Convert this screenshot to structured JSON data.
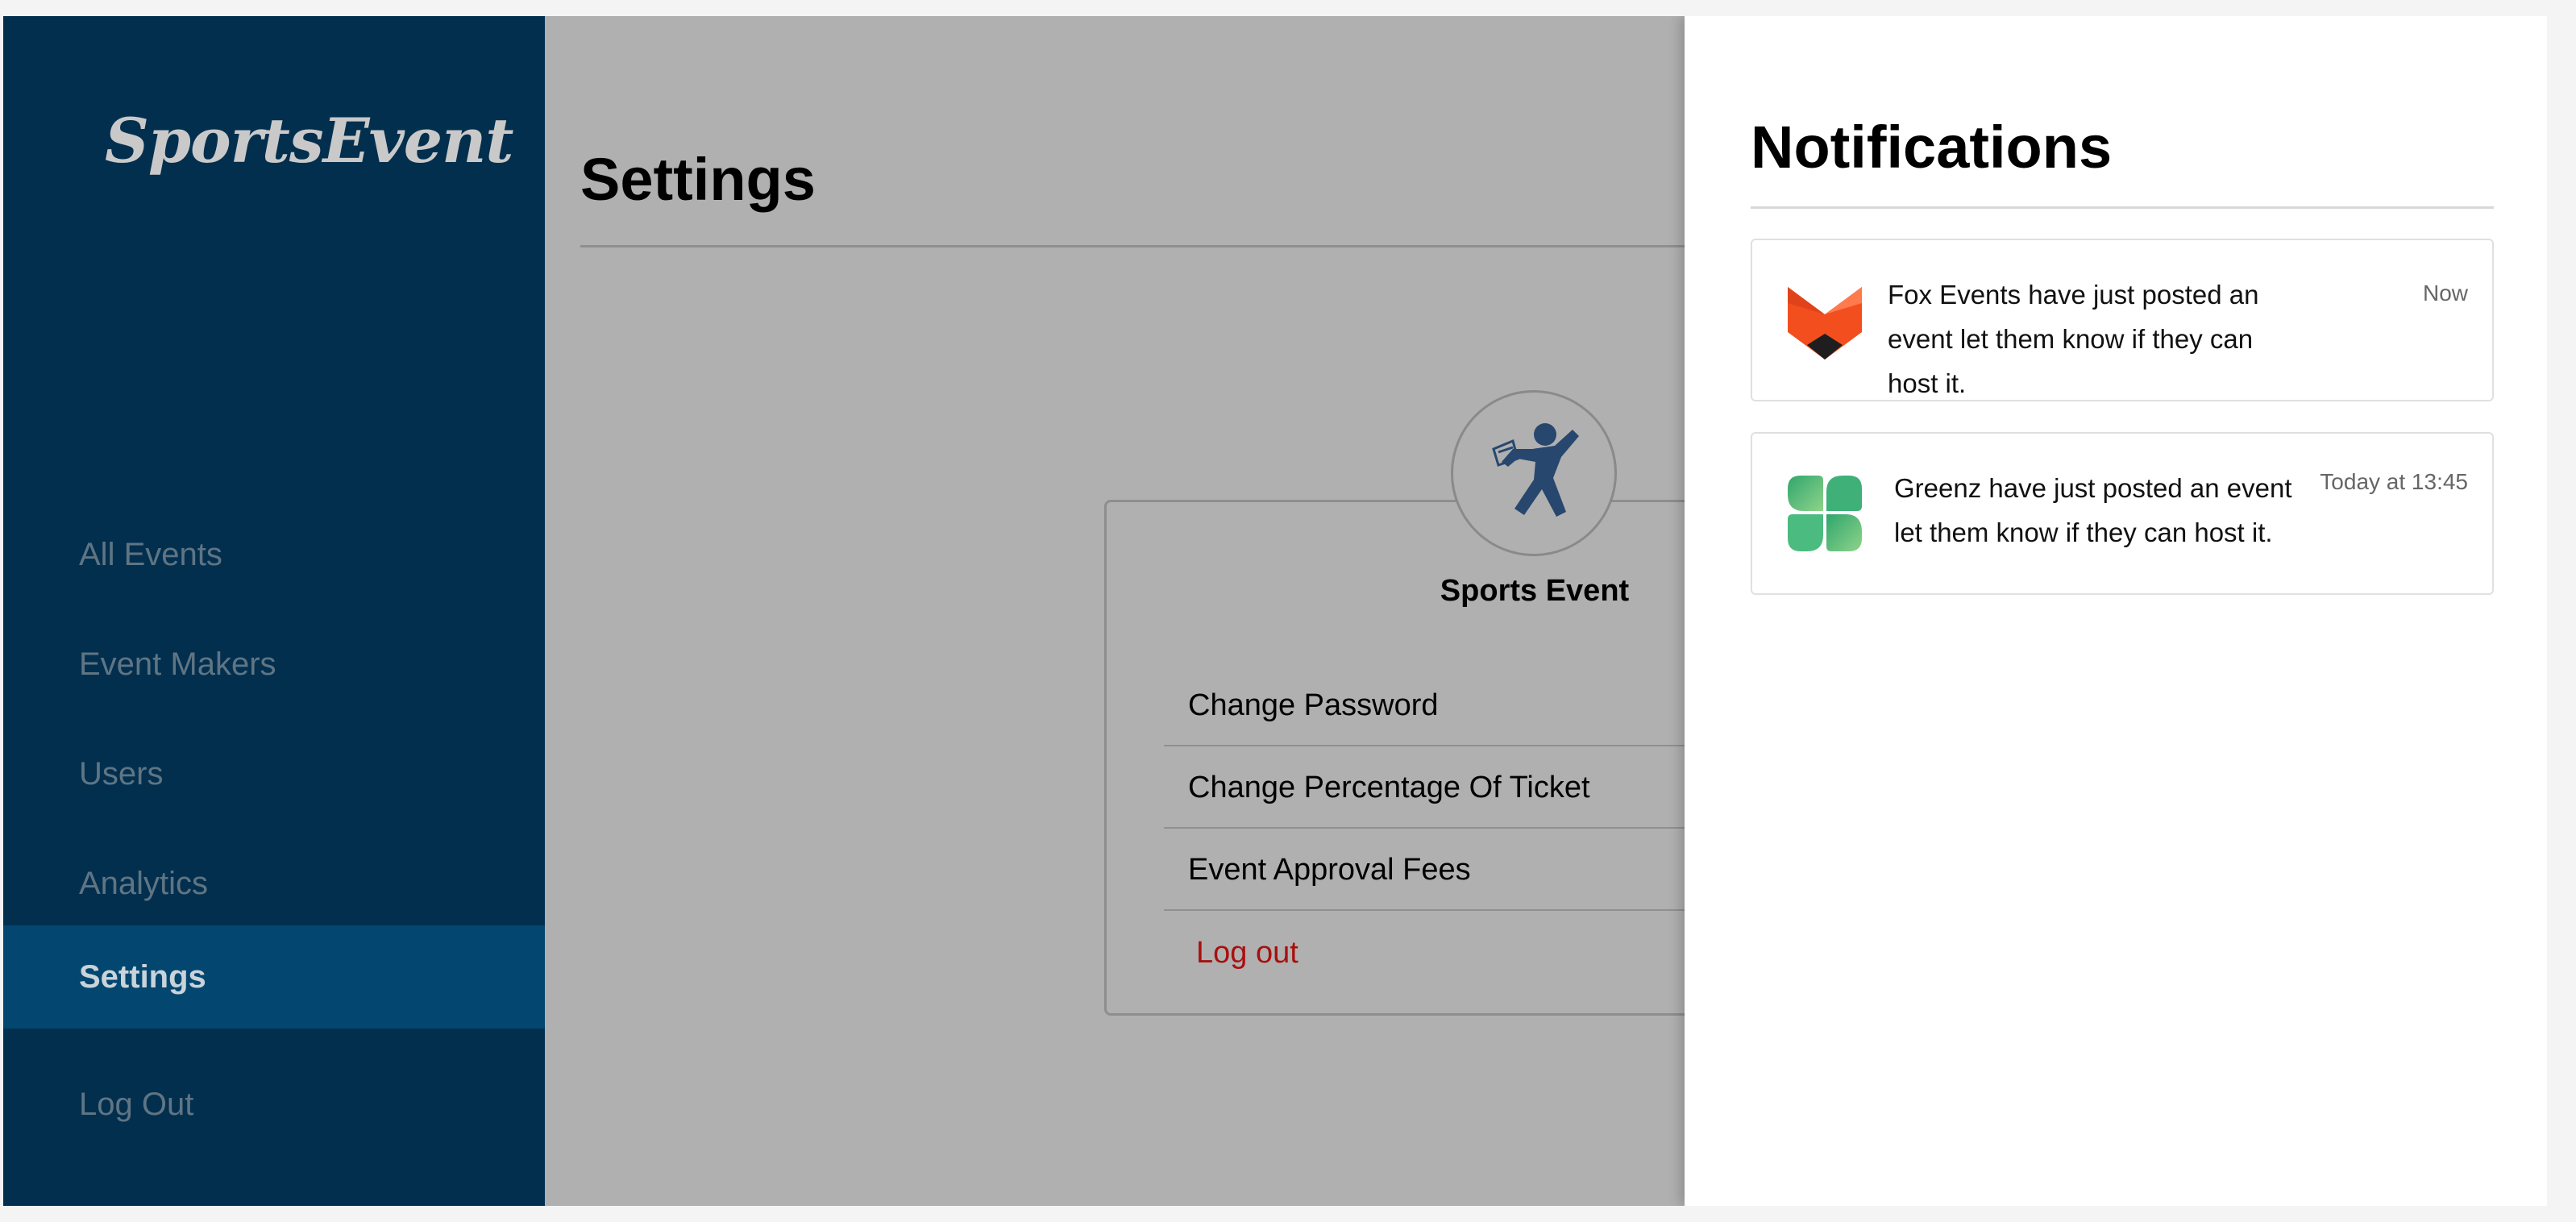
{
  "brand": {
    "logo_text": "SportsEvent"
  },
  "sidebar": {
    "items": [
      {
        "label": "All Events"
      },
      {
        "label": "Event Makers"
      },
      {
        "label": "Users"
      },
      {
        "label": "Analytics"
      },
      {
        "label": "Settings",
        "active": true
      },
      {
        "label": "Log Out"
      }
    ]
  },
  "main": {
    "title": "Settings",
    "profile": {
      "name": "Sports Event",
      "avatar_icon": "sports-player-icon"
    },
    "menu": [
      {
        "label": "Change Password"
      },
      {
        "label": "Change Percentage Of Ticket"
      },
      {
        "label": "Event Approval Fees"
      },
      {
        "label": "Log out"
      }
    ]
  },
  "notifications": {
    "title": "Notifications",
    "items": [
      {
        "icon": "fox-logo-icon",
        "text": "Fox Events have just posted an event let them know if they can host it.",
        "time": "Now"
      },
      {
        "icon": "clover-logo-icon",
        "text": "Greenz have just posted an event let them know if they can host it.",
        "time": "Today at 13:45"
      }
    ]
  },
  "colors": {
    "sidebar_bg": "#032f4f",
    "sidebar_active": "#03466f",
    "overlay_bg": "#b0b0b0",
    "logout_red": "#a80f0f",
    "fox_orange": "#f24e1e",
    "clover_green": "#4cbb7f"
  }
}
